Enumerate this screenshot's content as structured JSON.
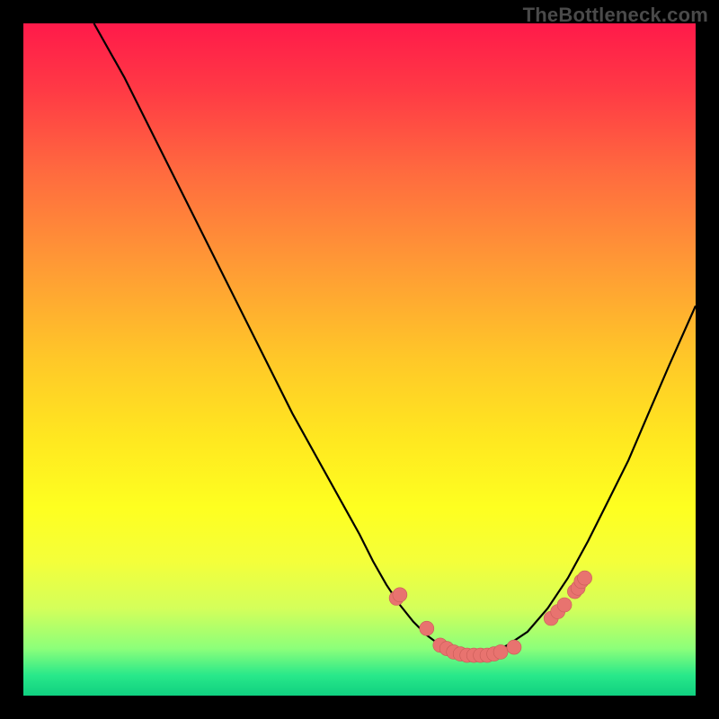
{
  "watermark": "TheBottleneck.com",
  "colors": {
    "background": "#000000",
    "curve": "#000000",
    "marker_fill": "#e8736f",
    "marker_stroke": "#c85c58"
  },
  "chart_data": {
    "type": "line",
    "title": "",
    "xlabel": "",
    "ylabel": "",
    "xlim": [
      0,
      100
    ],
    "ylim": [
      0,
      100
    ],
    "curve": {
      "x": [
        10.5,
        15,
        20,
        25,
        30,
        35,
        40,
        45,
        50,
        52,
        54,
        56,
        58,
        60,
        62,
        64,
        66,
        68,
        70,
        72,
        75,
        78,
        81,
        84,
        87,
        90,
        93,
        96,
        100
      ],
      "y": [
        100,
        92,
        82,
        72,
        62,
        52,
        42,
        33,
        24,
        20,
        16.5,
        13.5,
        11,
        9,
        7.5,
        6.5,
        6,
        6,
        6.5,
        7.5,
        9.5,
        13,
        17.5,
        23,
        29,
        35,
        42,
        49,
        58
      ]
    },
    "markers": [
      {
        "x": 55.5,
        "y": 14.5
      },
      {
        "x": 56,
        "y": 15
      },
      {
        "x": 60,
        "y": 10
      },
      {
        "x": 62,
        "y": 7.5
      },
      {
        "x": 63,
        "y": 7
      },
      {
        "x": 64,
        "y": 6.5
      },
      {
        "x": 65,
        "y": 6.2
      },
      {
        "x": 66,
        "y": 6
      },
      {
        "x": 67,
        "y": 6
      },
      {
        "x": 68,
        "y": 6
      },
      {
        "x": 69,
        "y": 6
      },
      {
        "x": 70,
        "y": 6.2
      },
      {
        "x": 71,
        "y": 6.5
      },
      {
        "x": 73,
        "y": 7.2
      },
      {
        "x": 78.5,
        "y": 11.5
      },
      {
        "x": 79.5,
        "y": 12.5
      },
      {
        "x": 80.5,
        "y": 13.5
      },
      {
        "x": 82,
        "y": 15.5
      },
      {
        "x": 82.5,
        "y": 16
      },
      {
        "x": 83,
        "y": 17
      },
      {
        "x": 83.5,
        "y": 17.5
      }
    ]
  }
}
